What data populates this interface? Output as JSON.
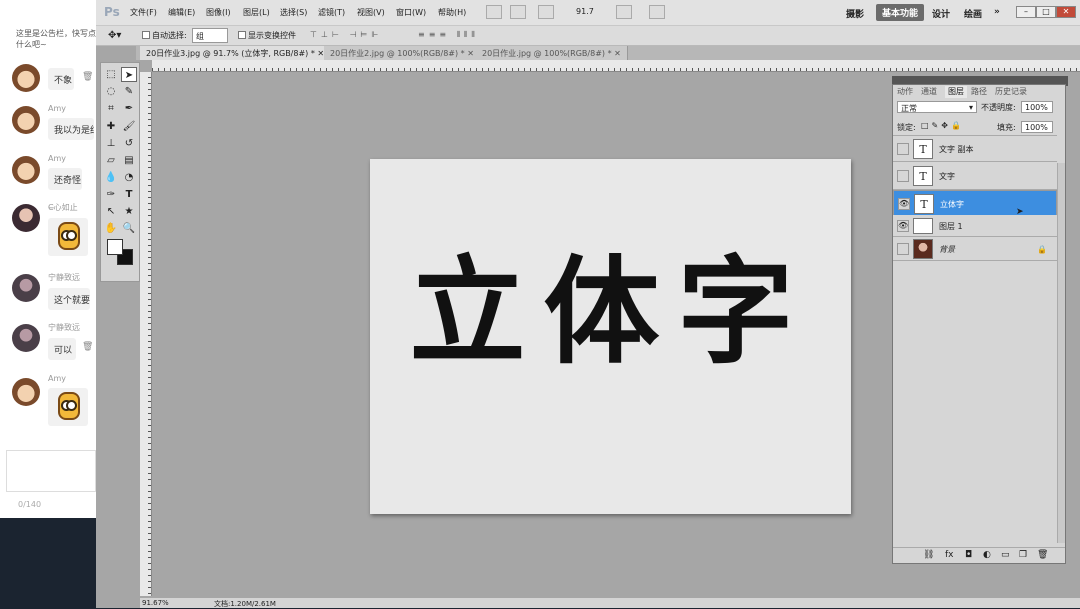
{
  "chat": {
    "notice": "这里是公告栏，快写点什么吧~",
    "messages": [
      {
        "avatar": "monkey-avatar",
        "name": "",
        "text": "不象"
      },
      {
        "avatar": "monkey-avatar",
        "name": "Amy",
        "text": "我以为是红"
      },
      {
        "avatar": "monkey-avatar",
        "name": "Amy",
        "text": "还奇怪"
      },
      {
        "avatar": "girl-avatar",
        "name": "C̶̶心如止",
        "text": ""
      },
      {
        "avatar": "dark-avatar",
        "name": "宁静致远",
        "text": "这个就要"
      },
      {
        "avatar": "dark-avatar",
        "name": "宁静致远",
        "text": "可以"
      },
      {
        "avatar": "monkey-avatar",
        "name": "Amy",
        "text": ""
      }
    ],
    "char_count": "0/140"
  },
  "app": {
    "logo": "Ps",
    "menus": [
      "文件(F)",
      "编辑(E)",
      "图像(I)",
      "图层(L)",
      "选择(S)",
      "滤镜(T)",
      "视图(V)",
      "窗口(W)",
      "帮助(H)"
    ],
    "zoom_value": "91.7",
    "workspaces": [
      "摄影",
      "基本功能",
      "设计",
      "绘画"
    ],
    "active_workspace": "基本功能",
    "more": "»"
  },
  "options": {
    "auto_select_label": "自动选择:",
    "auto_select_value": "组",
    "show_transform_label": "显示变换控件"
  },
  "tabs": [
    {
      "label": "20日作业3.jpg @ 91.7% (立体字, RGB/8#) *",
      "active": true
    },
    {
      "label": "20日作业2.jpg @ 100%(RGB/8#) *",
      "active": false
    },
    {
      "label": "20日作业.jpg @ 100%(RGB/8#) *",
      "active": false
    }
  ],
  "canvas": {
    "text": "立体字"
  },
  "status": {
    "zoom": "91.67%",
    "doc": "文档:1.20M/2.61M"
  },
  "layers_panel": {
    "tabs": [
      "动作",
      "通道",
      "图层",
      "路径",
      "历史记录"
    ],
    "active_tab": "图层",
    "blend_mode": "正常",
    "opacity_label": "不透明度:",
    "opacity_value": "100%",
    "lock_label": "锁定:",
    "fill_label": "填充:",
    "fill_value": "100%",
    "layers": [
      {
        "name": "文字 副本",
        "type": "text",
        "visible": false,
        "selected": false
      },
      {
        "name": "文字",
        "type": "text",
        "visible": false,
        "selected": false
      },
      {
        "name": "立体字",
        "type": "text",
        "visible": true,
        "selected": true
      },
      {
        "name": "图层 1",
        "type": "pixel",
        "visible": true,
        "selected": false
      },
      {
        "name": "背景",
        "type": "image",
        "visible": false,
        "selected": false,
        "locked": true
      }
    ]
  }
}
